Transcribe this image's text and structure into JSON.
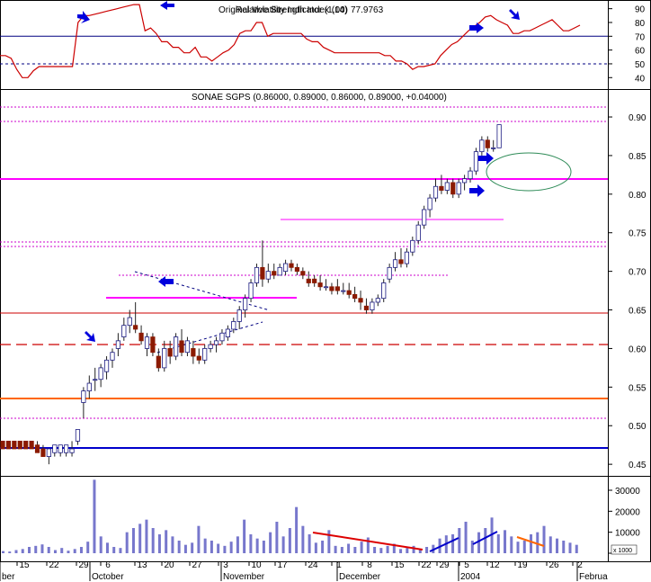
{
  "rsi_panel": {
    "title": "Relative Strength Index (14)",
    "value": "77.9763",
    "overlay_label": "Original Volatility Indicator (1.00)",
    "y_ticks": [
      "90",
      "80",
      "70",
      "60",
      "50",
      "40"
    ],
    "levels": [
      70,
      50
    ]
  },
  "price_panel": {
    "title": "SONAE SGPS (0.86000, 0.89000, 0.86000, 0.89000, +0.04000)",
    "y_ticks": [
      "0.90",
      "0.85",
      "0.80",
      "0.75",
      "0.70",
      "0.65",
      "0.60",
      "0.55",
      "0.50",
      "0.45"
    ]
  },
  "volume_panel": {
    "y_ticks": [
      "30000",
      "20000",
      "10000",
      "0"
    ],
    "unit_label": "x 1000"
  },
  "x_axis": {
    "day_labels": [
      "15",
      "22",
      "29",
      "6",
      "13",
      "20",
      "27",
      "3",
      "10",
      "17",
      "24",
      "1",
      "8",
      "15",
      "22",
      "29",
      "5",
      "12",
      "19",
      "26",
      "2"
    ],
    "month_labels": [
      "ber",
      "October",
      "November",
      "December",
      "2004",
      "Februa"
    ]
  },
  "chart_data": [
    {
      "type": "line",
      "name": "RSI",
      "ylim": [
        33,
        95
      ],
      "values": [
        56,
        56,
        54,
        46,
        40,
        40,
        45,
        48,
        48,
        48,
        48,
        48,
        48,
        48,
        80,
        85,
        85,
        86,
        87,
        88,
        89,
        90,
        91,
        92,
        93,
        93,
        74,
        76,
        72,
        66,
        66,
        62,
        62,
        58,
        58,
        62,
        55,
        55,
        52,
        55,
        58,
        60,
        64,
        72,
        74,
        74,
        80,
        80,
        70,
        72,
        72,
        72,
        72,
        72,
        72,
        68,
        66,
        66,
        62,
        60,
        58,
        58,
        58,
        58,
        58,
        58,
        58,
        58,
        58,
        56,
        56,
        52,
        52,
        50,
        46,
        48,
        48,
        49,
        50,
        56,
        60,
        64,
        66,
        70,
        74,
        77,
        80,
        84,
        85,
        82,
        80,
        78,
        72,
        72,
        74,
        74,
        76,
        78,
        80,
        82,
        78,
        74,
        74,
        76,
        78
      ]
    },
    {
      "type": "candlestick",
      "name": "SONAE SGPS",
      "ylim": [
        0.435,
        0.935
      ],
      "candles": [
        [
          0.48,
          0.48,
          0.47,
          0.47
        ],
        [
          0.48,
          0.48,
          0.47,
          0.47
        ],
        [
          0.48,
          0.48,
          0.47,
          0.47
        ],
        [
          0.48,
          0.48,
          0.47,
          0.47
        ],
        [
          0.48,
          0.48,
          0.47,
          0.47
        ],
        [
          0.48,
          0.48,
          0.47,
          0.47
        ],
        [
          0.475,
          0.48,
          0.465,
          0.465
        ],
        [
          0.47,
          0.475,
          0.46,
          0.46
        ],
        [
          0.46,
          0.47,
          0.45,
          0.47
        ],
        [
          0.465,
          0.475,
          0.46,
          0.475
        ],
        [
          0.465,
          0.475,
          0.46,
          0.475
        ],
        [
          0.465,
          0.475,
          0.46,
          0.475
        ],
        [
          0.465,
          0.48,
          0.46,
          0.47
        ],
        [
          0.48,
          0.495,
          0.475,
          0.495
        ],
        [
          0.53,
          0.55,
          0.51,
          0.545
        ],
        [
          0.545,
          0.565,
          0.535,
          0.555
        ],
        [
          0.56,
          0.575,
          0.545,
          0.56
        ],
        [
          0.56,
          0.58,
          0.55,
          0.575
        ],
        [
          0.57,
          0.59,
          0.56,
          0.585
        ],
        [
          0.585,
          0.6,
          0.575,
          0.595
        ],
        [
          0.6,
          0.62,
          0.59,
          0.61
        ],
        [
          0.615,
          0.64,
          0.61,
          0.63
        ],
        [
          0.63,
          0.65,
          0.62,
          0.64
        ],
        [
          0.63,
          0.66,
          0.62,
          0.625
        ],
        [
          0.62,
          0.63,
          0.605,
          0.61
        ],
        [
          0.6,
          0.62,
          0.59,
          0.615
        ],
        [
          0.615,
          0.62,
          0.59,
          0.595
        ],
        [
          0.59,
          0.6,
          0.57,
          0.575
        ],
        [
          0.575,
          0.61,
          0.57,
          0.6
        ],
        [
          0.6,
          0.61,
          0.58,
          0.59
        ],
        [
          0.59,
          0.62,
          0.585,
          0.615
        ],
        [
          0.61,
          0.625,
          0.59,
          0.595
        ],
        [
          0.595,
          0.615,
          0.59,
          0.61
        ],
        [
          0.6,
          0.61,
          0.58,
          0.59
        ],
        [
          0.59,
          0.6,
          0.58,
          0.585
        ],
        [
          0.585,
          0.605,
          0.58,
          0.6
        ],
        [
          0.6,
          0.61,
          0.595,
          0.605
        ],
        [
          0.605,
          0.615,
          0.595,
          0.61
        ],
        [
          0.61,
          0.625,
          0.605,
          0.62
        ],
        [
          0.615,
          0.63,
          0.61,
          0.625
        ],
        [
          0.625,
          0.64,
          0.62,
          0.635
        ],
        [
          0.635,
          0.655,
          0.625,
          0.65
        ],
        [
          0.65,
          0.67,
          0.64,
          0.665
        ],
        [
          0.665,
          0.69,
          0.66,
          0.685
        ],
        [
          0.685,
          0.71,
          0.68,
          0.705
        ],
        [
          0.705,
          0.74,
          0.68,
          0.69
        ],
        [
          0.69,
          0.71,
          0.685,
          0.7
        ],
        [
          0.7,
          0.71,
          0.69,
          0.695
        ],
        [
          0.695,
          0.71,
          0.695,
          0.705
        ],
        [
          0.7,
          0.715,
          0.695,
          0.71
        ],
        [
          0.71,
          0.715,
          0.7,
          0.705
        ],
        [
          0.705,
          0.71,
          0.695,
          0.7
        ],
        [
          0.7,
          0.705,
          0.69,
          0.695
        ],
        [
          0.69,
          0.7,
          0.68,
          0.685
        ],
        [
          0.69,
          0.695,
          0.68,
          0.685
        ],
        [
          0.685,
          0.695,
          0.675,
          0.68
        ],
        [
          0.68,
          0.69,
          0.675,
          0.68
        ],
        [
          0.68,
          0.685,
          0.67,
          0.675
        ],
        [
          0.68,
          0.69,
          0.67,
          0.675
        ],
        [
          0.675,
          0.685,
          0.67,
          0.675
        ],
        [
          0.675,
          0.685,
          0.665,
          0.67
        ],
        [
          0.67,
          0.68,
          0.66,
          0.665
        ],
        [
          0.665,
          0.675,
          0.65,
          0.66
        ],
        [
          0.655,
          0.665,
          0.645,
          0.65
        ],
        [
          0.65,
          0.665,
          0.645,
          0.66
        ],
        [
          0.66,
          0.67,
          0.655,
          0.665
        ],
        [
          0.665,
          0.69,
          0.66,
          0.685
        ],
        [
          0.69,
          0.71,
          0.685,
          0.705
        ],
        [
          0.705,
          0.725,
          0.7,
          0.715
        ],
        [
          0.715,
          0.73,
          0.705,
          0.71
        ],
        [
          0.71,
          0.73,
          0.705,
          0.725
        ],
        [
          0.725,
          0.745,
          0.72,
          0.74
        ],
        [
          0.74,
          0.765,
          0.735,
          0.76
        ],
        [
          0.76,
          0.785,
          0.755,
          0.78
        ],
        [
          0.78,
          0.8,
          0.77,
          0.795
        ],
        [
          0.795,
          0.82,
          0.79,
          0.81
        ],
        [
          0.81,
          0.825,
          0.8,
          0.805
        ],
        [
          0.805,
          0.82,
          0.8,
          0.815
        ],
        [
          0.815,
          0.82,
          0.795,
          0.8
        ],
        [
          0.8,
          0.82,
          0.795,
          0.815
        ],
        [
          0.815,
          0.825,
          0.805,
          0.82
        ],
        [
          0.82,
          0.835,
          0.815,
          0.83
        ],
        [
          0.83,
          0.86,
          0.825,
          0.855
        ],
        [
          0.855,
          0.875,
          0.85,
          0.87
        ],
        [
          0.87,
          0.875,
          0.855,
          0.86
        ],
        [
          0.86,
          0.87,
          0.855,
          0.86
        ],
        [
          0.86,
          0.89,
          0.86,
          0.89
        ]
      ]
    },
    {
      "type": "bar",
      "name": "Volume",
      "ylim": [
        0,
        36000
      ],
      "values": [
        1000,
        800,
        1500,
        2000,
        3000,
        3500,
        4200,
        3000,
        1500,
        2500,
        1200,
        2000,
        3000,
        5500,
        35000,
        8000,
        5000,
        3000,
        2500,
        10000,
        12000,
        14000,
        16000,
        12000,
        9000,
        11000,
        8000,
        6000,
        4000,
        5000,
        13000,
        7000,
        6000,
        4500,
        3500,
        5500,
        8000,
        16000,
        9000,
        7000,
        6000,
        10000,
        15000,
        8000,
        12000,
        22000,
        13000,
        9000,
        5000,
        6000,
        11000,
        3500,
        3000,
        4500,
        3000,
        5500,
        7500,
        3000,
        2500,
        3500,
        4500,
        2000,
        2500,
        3500,
        2000,
        3000,
        4000,
        7000,
        8500,
        9000,
        12000,
        15000,
        6000,
        10000,
        12000,
        17000,
        9000,
        11000,
        8000,
        5500,
        6000,
        9000,
        10000,
        13000,
        8000,
        7000,
        6000,
        5000,
        4000
      ]
    }
  ]
}
